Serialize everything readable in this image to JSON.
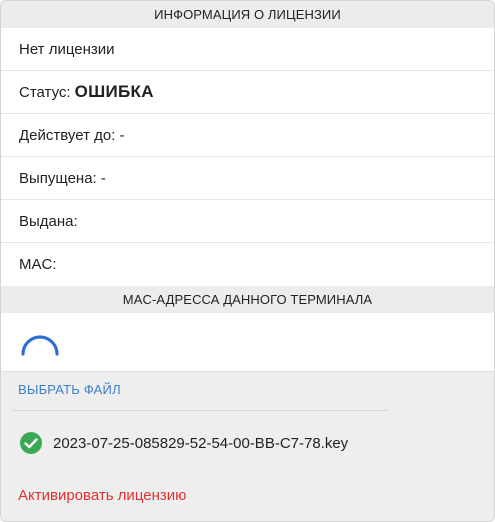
{
  "license_info": {
    "header": "ИНФОРМАЦИЯ О ЛИЦЕНЗИИ",
    "no_license": "Нет лицензии",
    "status_label": "Статус:",
    "status_value": "ОШИБКА",
    "valid_until": "Действует до: -",
    "issued": "Выпущена: -",
    "issued_to": "Выдана:",
    "mac": "MAC:"
  },
  "mac_section": {
    "header": "MAC-АДРЕССА ДАННОГО ТЕРМИНАЛА"
  },
  "file_section": {
    "choose_file": "ВЫБРАТЬ ФАЙЛ",
    "file_name": "2023-07-25-085829-52-54-00-BB-C7-78.key",
    "activate": "Активировать лицензию"
  },
  "colors": {
    "link_blue": "#3d7fc9",
    "success_green": "#3aa856",
    "danger_red": "#e33030",
    "spinner_blue": "#2f6fd1"
  },
  "icons": {
    "loading": "spinner-icon",
    "file_ok": "check-circle-icon"
  }
}
